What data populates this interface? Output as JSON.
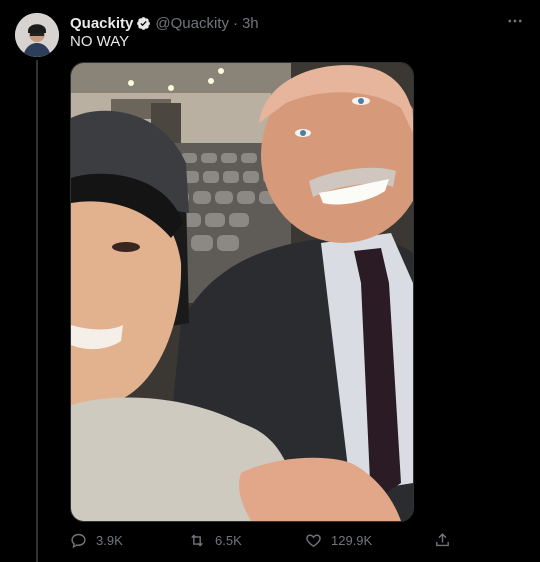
{
  "tweet": {
    "author_name": "Quackity",
    "author_handle": "@Quackity",
    "separator": "·",
    "time": "3h",
    "text": "NO WAY",
    "verified": true
  },
  "actions": {
    "reply_count": "3.9K",
    "retweet_count": "6.5K",
    "like_count": "129.9K"
  },
  "icons": {
    "reply": "reply-icon",
    "retweet": "retweet-icon",
    "like": "heart-icon",
    "share": "share-icon",
    "more": "more-icon",
    "verified": "verified-badge-icon"
  },
  "colors": {
    "background": "#000000",
    "text_primary": "#e7e9ea",
    "text_secondary": "#71767b",
    "divider": "#2f3336"
  }
}
